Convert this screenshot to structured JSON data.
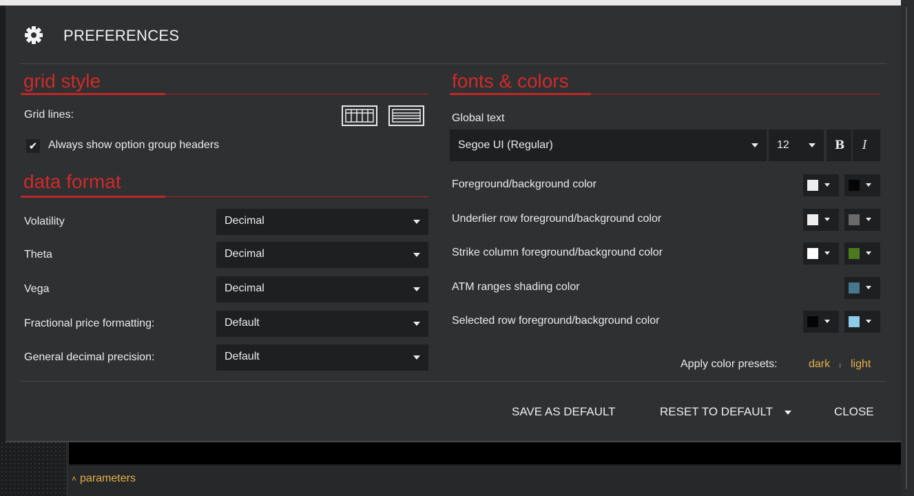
{
  "dialog": {
    "title": "PREFERENCES",
    "icon": "gear-icon"
  },
  "grid_style": {
    "title": "grid style",
    "grid_lines_label": "Grid lines:",
    "always_show_headers": {
      "label": "Always show option group headers",
      "checked": true
    }
  },
  "data_format": {
    "title": "data format",
    "rows": [
      {
        "label": "Volatility",
        "value": "Decimal"
      },
      {
        "label": "Theta",
        "value": "Decimal"
      },
      {
        "label": "Vega",
        "value": "Decimal"
      },
      {
        "label": "Fractional price formatting:",
        "value": "Default"
      },
      {
        "label": "General decimal precision:",
        "value": "Default"
      }
    ]
  },
  "fonts_colors": {
    "title": "fonts & colors",
    "global_text_label": "Global text",
    "font_family": "Segoe UI (Regular)",
    "font_size": "12",
    "bold_label": "B",
    "italic_label": "I",
    "color_rows": [
      {
        "label": "Foreground/background color",
        "fg": "#eeeeee",
        "bg": "#050505"
      },
      {
        "label": "Underlier row foreground/background color",
        "fg": "#eeeeee",
        "bg": "#6a6a6a"
      },
      {
        "label": "Strike column foreground/background color",
        "fg": "#ffffff",
        "bg": "#4a7a1c"
      },
      {
        "label": "ATM ranges shading color",
        "bg": "#4a7590"
      },
      {
        "label": "Selected row foreground/background color",
        "fg": "#050505",
        "bg": "#8ecbe6"
      }
    ],
    "presets_label": "Apply color presets:",
    "preset_dark": "dark",
    "preset_separator": "ı",
    "preset_light": "light"
  },
  "footer": {
    "save_default": "SAVE AS DEFAULT",
    "reset_default": "RESET TO DEFAULT",
    "close": "CLOSE"
  },
  "background": {
    "parameters_link": "parameters"
  },
  "colors": {
    "accent_red": "#d12a2a",
    "link_gold": "#e6b24a"
  }
}
